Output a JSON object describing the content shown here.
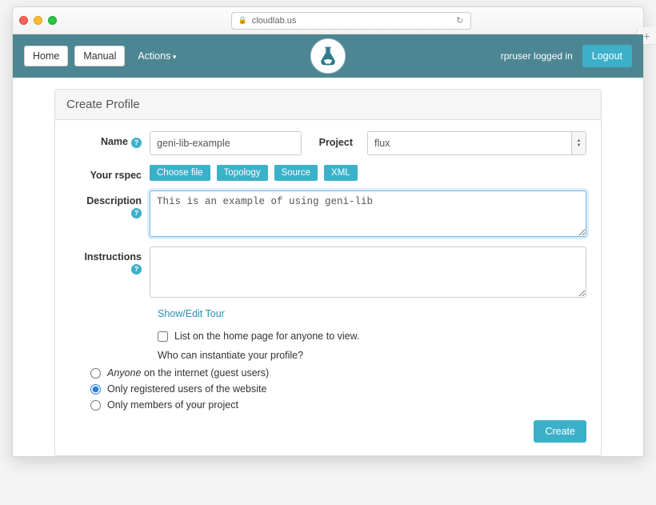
{
  "browser": {
    "url": "cloudlab.us"
  },
  "nav": {
    "home": "Home",
    "manual": "Manual",
    "actions": "Actions",
    "logged_in": "rpruser logged in",
    "logout": "Logout"
  },
  "panel": {
    "title": "Create Profile"
  },
  "form": {
    "name_label": "Name",
    "name_value": "geni-lib-example",
    "project_label": "Project",
    "project_value": "flux",
    "rspec_label": "Your rspec",
    "choose_file": "Choose file",
    "topology": "Topology",
    "source": "Source",
    "xml": "XML",
    "description_label": "Description",
    "description_value": "This is an example of using geni-lib",
    "instructions_label": "Instructions",
    "instructions_value": "",
    "tour_link": "Show/Edit Tour",
    "list_checkbox": "List on the home page for anyone to view.",
    "instantiate_q": "Who can instantiate your profile?",
    "radio_anyone_prefix": "Anyone",
    "radio_anyone_suffix": " on the internet (guest users)",
    "radio_registered": "Only registered users of the website",
    "radio_members": "Only members of your project",
    "create": "Create"
  }
}
